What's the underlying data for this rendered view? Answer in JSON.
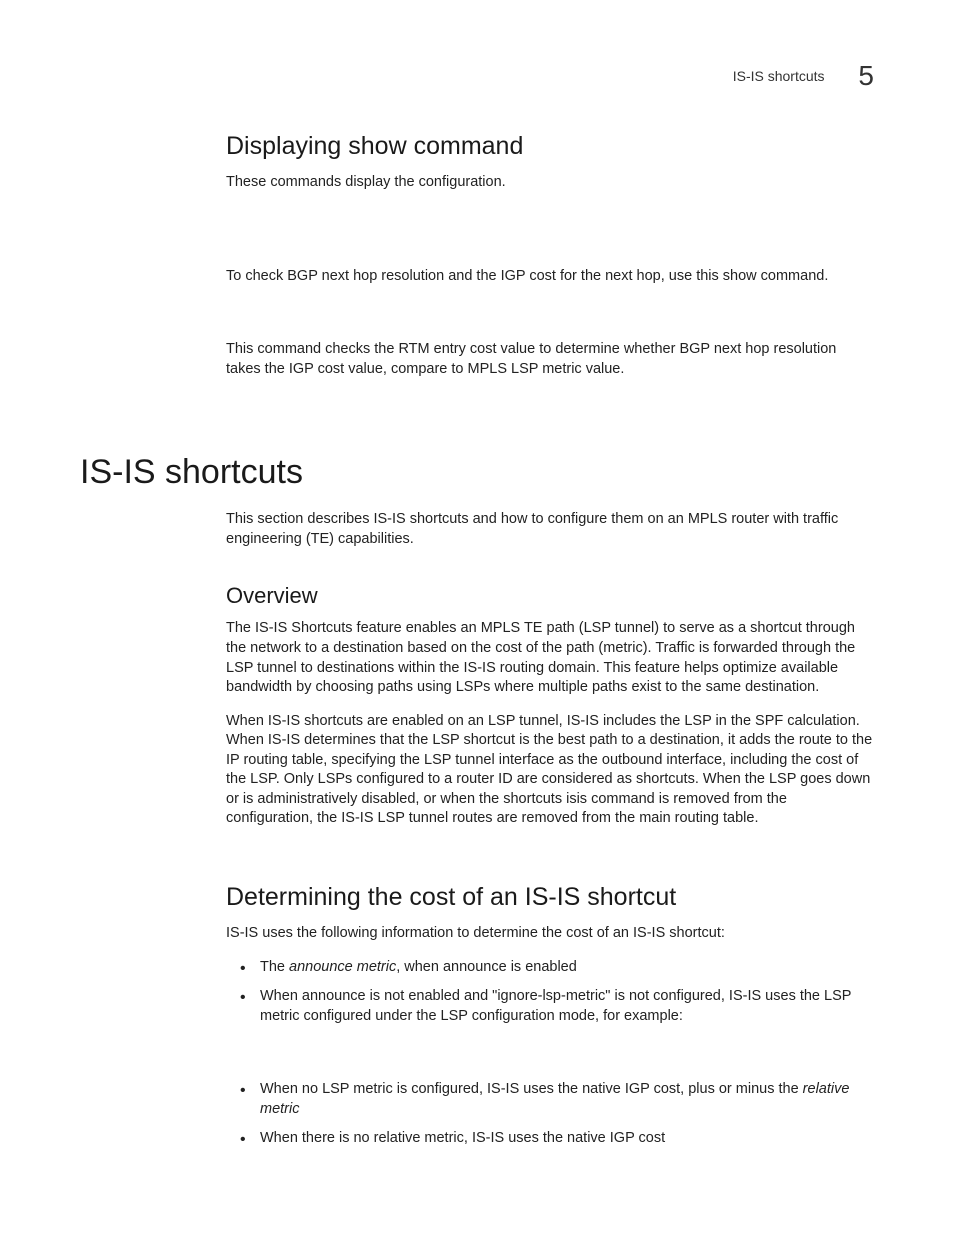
{
  "header": {
    "section_name": "IS-IS shortcuts",
    "chapter_number": "5"
  },
  "sec_display": {
    "title": "Displaying show command",
    "p1": "These commands display the configuration.",
    "p2": "To check BGP next hop resolution and the IGP cost for the next hop, use this show command.",
    "p3": "This command checks the RTM entry cost value to determine whether BGP next hop resolution takes the IGP cost value, compare to MPLS LSP metric value."
  },
  "chapter": {
    "title": "IS-IS shortcuts",
    "intro": "This section describes IS-IS shortcuts and how to configure them on an MPLS router with traffic engineering (TE) capabilities."
  },
  "overview": {
    "title": "Overview",
    "p1": "The IS-IS Shortcuts feature enables an MPLS TE path (LSP tunnel) to serve as a shortcut through the network to a destination based on the cost of the path (metric). Traffic is forwarded through the LSP tunnel to destinations within the IS-IS routing domain. This feature helps optimize available bandwidth by choosing paths using LSPs where multiple paths exist to the same destination.",
    "p2": "When IS-IS shortcuts are enabled on an LSP tunnel, IS-IS includes the LSP in the SPF calculation. When IS-IS determines that the LSP shortcut is the best path to a destination, it adds the route to the IP routing table, specifying the LSP tunnel interface as the outbound interface, including the cost of the LSP. Only LSPs configured to a router ID are considered as shortcuts. When the LSP goes down or is administratively disabled, or when the shortcuts isis command is removed from the configuration, the IS-IS LSP tunnel routes are removed from the main routing table."
  },
  "cost": {
    "title": "Determining the cost of an IS-IS shortcut",
    "lead": "IS-IS uses the following information to determine the cost of an IS-IS shortcut:",
    "bullets": {
      "b1_pre": "The ",
      "b1_em": "announce metric",
      "b1_post": ", when announce is enabled",
      "b2": "When announce is not enabled and \"ignore-lsp-metric\" is not configured, IS-IS uses the LSP metric configured under the LSP configuration mode, for example:",
      "b3_pre": "When no LSP metric is configured, IS-IS uses the native IGP cost, plus or minus the ",
      "b3_em": "relative metric",
      "b4": "When there is no relative metric, IS-IS uses the native IGP cost"
    }
  }
}
